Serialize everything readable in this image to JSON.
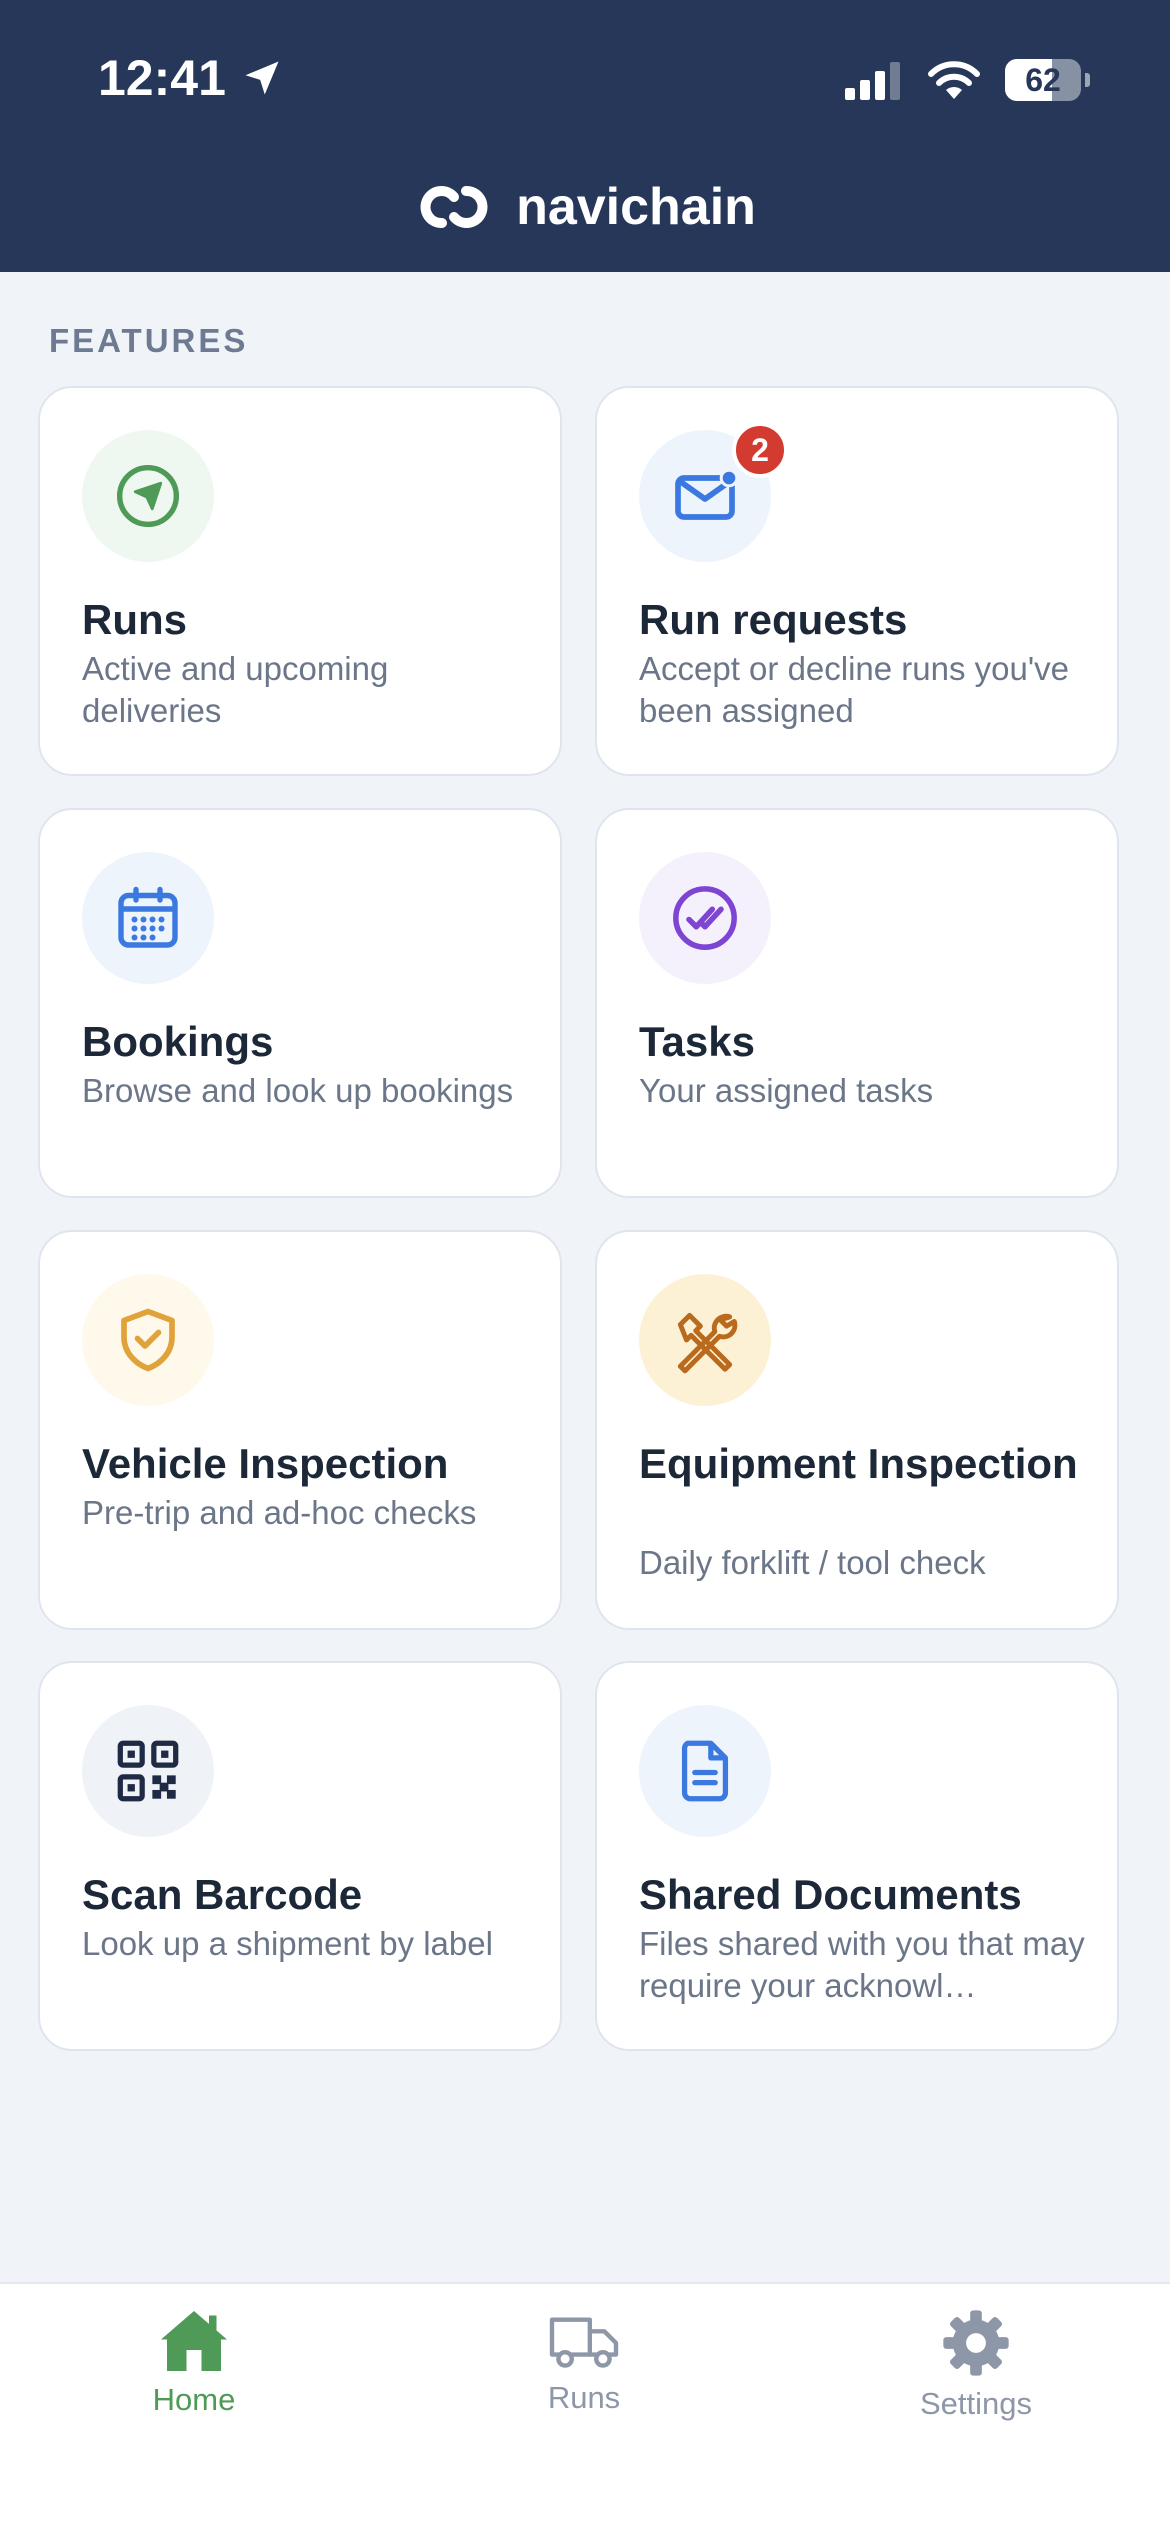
{
  "status_bar": {
    "time": "12:41",
    "battery": "62"
  },
  "app": {
    "name": "navichain"
  },
  "section_title": "FEATURES",
  "features": [
    {
      "title": "Runs",
      "description": "Active and upcoming deliveries",
      "icon": "navigation-arrow-icon",
      "color": "#4f9a57",
      "bg": "#eef8f0"
    },
    {
      "title": "Run requests",
      "description": "Accept or decline runs you've been assigned",
      "icon": "envelope-icon",
      "badge": "2",
      "color": "#3b78e0",
      "bg": "#eef4fc"
    },
    {
      "title": "Bookings",
      "description": "Browse and look up bookings",
      "icon": "calendar-icon",
      "color": "#3b78e0",
      "bg": "#eef4fc"
    },
    {
      "title": "Tasks",
      "description": "Your assigned tasks",
      "icon": "check-circle-icon",
      "color": "#7d45d1",
      "bg": "#f4f1fd"
    },
    {
      "title": "Vehicle Inspection",
      "description": "Pre-trip and ad-hoc checks",
      "icon": "shield-check-icon",
      "color": "#e0a23b",
      "bg": "#fff9eb"
    },
    {
      "title": "Equipment Inspection",
      "description": "Daily forklift / tool check",
      "icon": "tools-icon",
      "color": "#b96a1d",
      "bg": "#fdf1d5"
    },
    {
      "title": "Scan Barcode",
      "description": "Look up a shipment by label",
      "icon": "qr-code-icon",
      "color": "#1f2a44",
      "bg": "#eff2f6"
    },
    {
      "title": "Shared Documents",
      "description": "Files shared with you that may require your acknowl…",
      "icon": "document-icon",
      "color": "#3b78e0",
      "bg": "#eef4fc"
    }
  ],
  "tabbar": {
    "items": [
      {
        "label": "Home",
        "icon": "home-icon",
        "active": true
      },
      {
        "label": "Runs",
        "icon": "truck-icon",
        "active": false
      },
      {
        "label": "Settings",
        "icon": "gear-icon",
        "active": false
      }
    ],
    "active_color": "#4f9a57",
    "inactive_color": "#8d97a8"
  }
}
